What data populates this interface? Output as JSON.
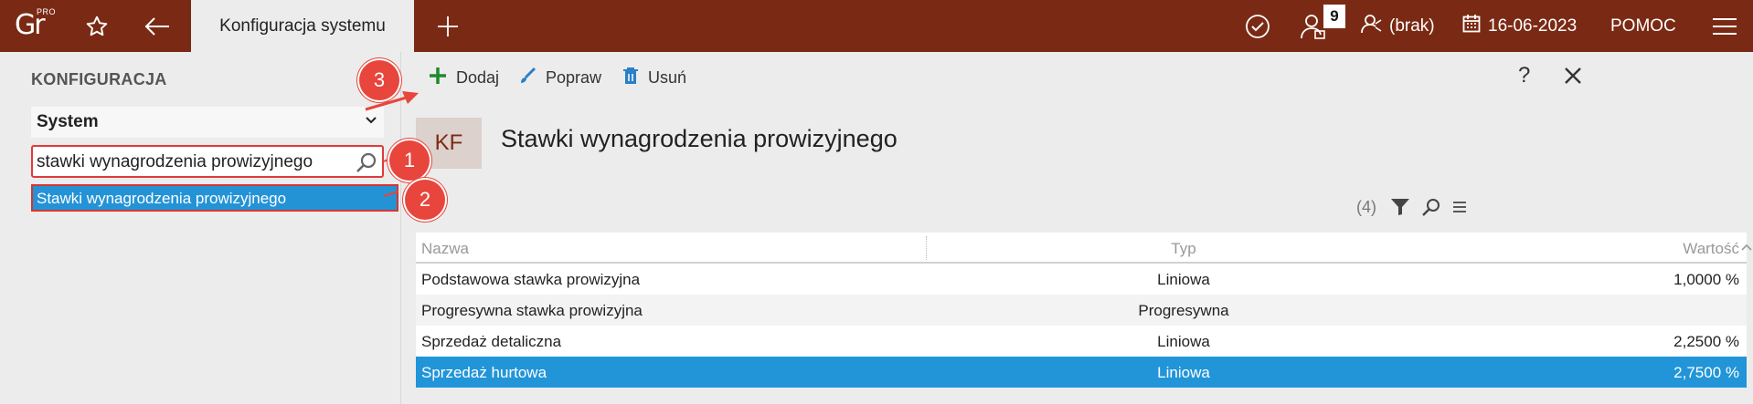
{
  "app": {
    "logo_text": "Gr",
    "logo_badge": "PRO"
  },
  "topbar": {
    "active_tab": "Konfiguracja systemu",
    "notifications_count": "9",
    "user": "(brak)",
    "date": "16-06-2023",
    "help": "POMOC"
  },
  "left": {
    "title": "KONFIGURACJA",
    "select_value": "System",
    "search_value": "stawki wynagrodzenia prowizyjnego",
    "result_item": "Stawki wynagrodzenia prowizyjnego"
  },
  "markers": [
    "1",
    "2",
    "3"
  ],
  "toolbar": {
    "add": "Dodaj",
    "edit": "Popraw",
    "delete": "Usuń",
    "help": "?"
  },
  "content": {
    "badge": "KF",
    "title": "Stawki wynagrodzenia prowizyjnego",
    "count": "(4)"
  },
  "grid": {
    "columns": [
      "Nazwa",
      "Typ",
      "Wartość"
    ],
    "rows": [
      {
        "name": "Podstawowa stawka prowizyjna",
        "type": "Liniowa",
        "value": "1,0000 %"
      },
      {
        "name": "Progresywna stawka prowizyjna",
        "type": "Progresywna",
        "value": ""
      },
      {
        "name": "Sprzedaż detaliczna",
        "type": "Liniowa",
        "value": "2,2500 %"
      },
      {
        "name": "Sprzedaż hurtowa",
        "type": "Liniowa",
        "value": "2,7500 %"
      }
    ]
  },
  "colors": {
    "topbar": "#7a2a14",
    "accent_blue": "#2195d8",
    "marker_red": "#e8453c",
    "add_green": "#1e8a2e"
  }
}
